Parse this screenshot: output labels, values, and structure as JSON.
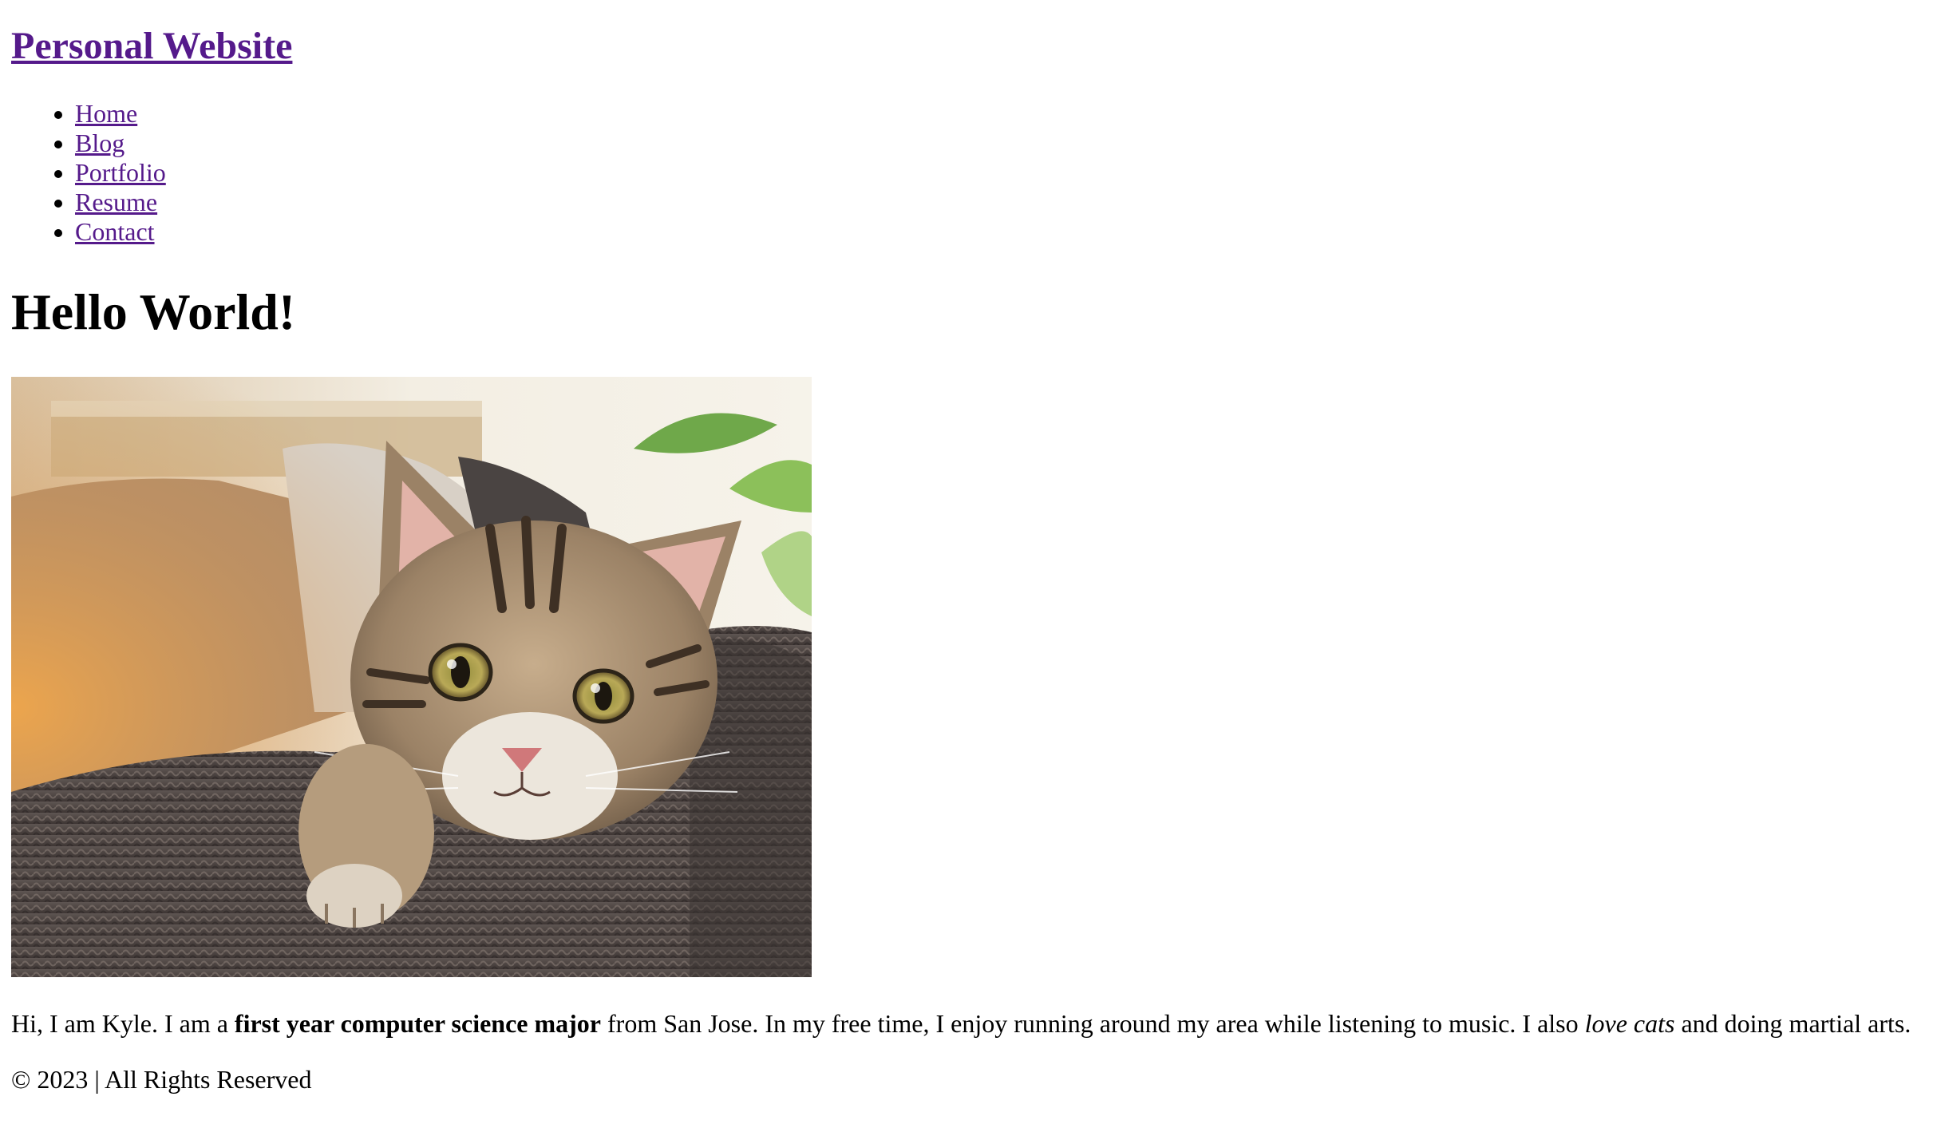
{
  "header": {
    "site_title": "Personal Website"
  },
  "nav": {
    "items": [
      {
        "label": "Home"
      },
      {
        "label": "Blog"
      },
      {
        "label": "Portfolio"
      },
      {
        "label": "Resume"
      },
      {
        "label": "Contact"
      }
    ]
  },
  "main": {
    "heading": "Hello World!",
    "bio": {
      "part1": "Hi, I am Kyle. I am a ",
      "bold": "first year computer science major",
      "part2": " from San Jose. In my free time, I enjoy running around my area while listening to music. I also ",
      "italic": "love cats",
      "part3": " and doing martial arts."
    }
  },
  "footer": {
    "text": "© 2023 | All Rights Reserved"
  },
  "colors": {
    "link": "#551a8b",
    "text": "#000000",
    "background": "#ffffff"
  }
}
